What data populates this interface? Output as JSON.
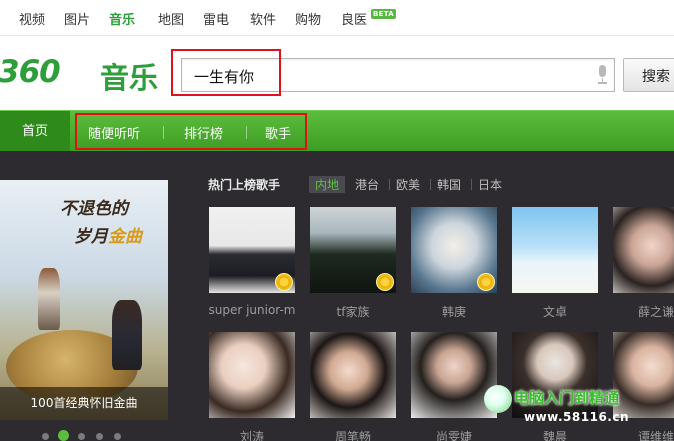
{
  "topnav": {
    "items": [
      "视频",
      "图片",
      "音乐",
      "地图",
      "雷电",
      "软件",
      "购物",
      "良医"
    ],
    "active": "音乐",
    "beta_label": "BETA"
  },
  "brand": {
    "number": "360",
    "name": "音乐"
  },
  "search": {
    "value": "一生有你",
    "button_label": "搜索"
  },
  "green_nav": {
    "home": "首页",
    "links": [
      "随便听听",
      "排行榜",
      "歌手"
    ]
  },
  "banner": {
    "title_line1": "不退色的",
    "title_line2a": "岁月",
    "title_line2b": "金曲",
    "caption": "100首经典怀旧金曲"
  },
  "singers_section": {
    "title": "热门上榜歌手",
    "regions": [
      "内地",
      "港台",
      "欧美",
      "韩国",
      "日本"
    ],
    "active_region": "内地",
    "row1": [
      "super junior-m",
      "tf家族",
      "韩庚",
      "文卓",
      "薛之谦"
    ],
    "row2": [
      "刘涛",
      "周笔畅",
      "尚雯婕",
      "魏晨",
      "谭维维"
    ]
  },
  "watermark": {
    "text": "电脑入门到精通",
    "url": "www.58116.cn"
  },
  "colors": {
    "brand_green": "#2e9e3a",
    "nav_green": "#4fac30",
    "highlight_red": "#e0101d",
    "content_dark": "#2d2b30"
  }
}
